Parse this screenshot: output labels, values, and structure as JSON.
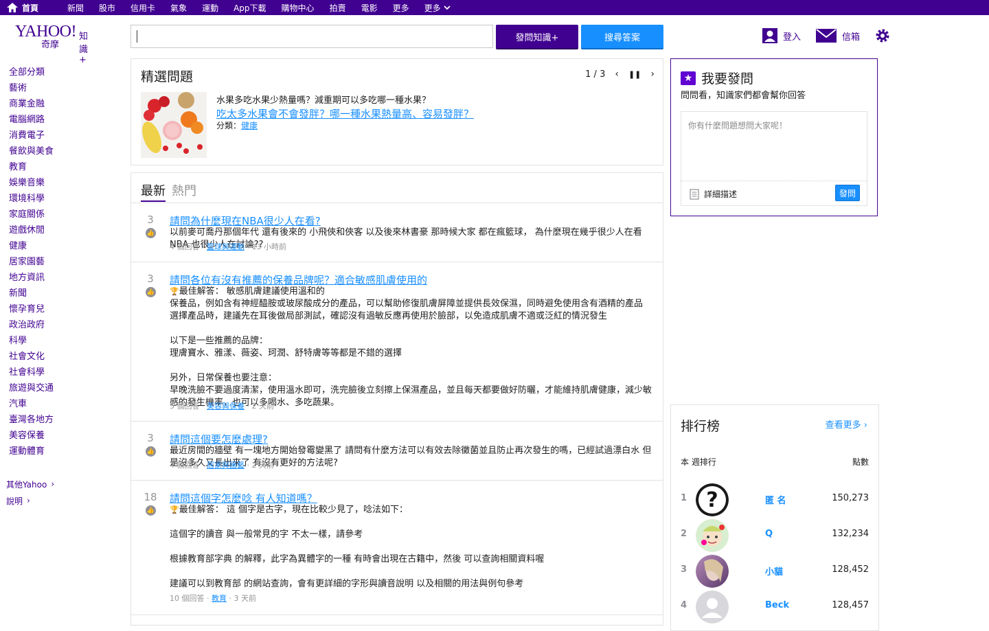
{
  "topnav": {
    "items": [
      "首頁",
      "新聞",
      "股市",
      "信用卡",
      "氣象",
      "運動",
      "App下載",
      "購物中心",
      "拍賣",
      "電影",
      "更多"
    ]
  },
  "header": {
    "logo_main": "YAHOO!",
    "logo_sub": "奇摩",
    "logo_tag": "知識+",
    "ask_button": "發問知識+",
    "search_button": "搜尋答案",
    "account_label": "登入",
    "mail_label": "信箱"
  },
  "leftnav": {
    "items": [
      "全部分類",
      "藝術",
      "商業金融",
      "電腦網路",
      "消費電子",
      "餐飲與美食",
      "教育",
      "娛樂音樂",
      "環境科學",
      "家庭關係",
      "遊戲休閒",
      "健康",
      "居家園藝",
      "地方資訊",
      "新聞",
      "懷孕育兒",
      "政治政府",
      "科學",
      "社會文化",
      "社會科學",
      "旅遊與交通",
      "汽車",
      "臺灣各地方",
      "美容保養",
      "運動體育"
    ],
    "footer": [
      "其他Yahoo",
      "說明"
    ]
  },
  "featured": {
    "title": "精選問題",
    "pager": "1 / 3",
    "desc": "水果多吃水果少熱量嗎？減重期可以多吃哪一種水果？",
    "question": "吃太多水果會不會發胖？哪一種水果熱量高、容易發胖？",
    "cat_prefix": "分類：",
    "category": "健康"
  },
  "tabs": {
    "active": "最新",
    "inactive": "熱門"
  },
  "questions": [
    {
      "votes": "3",
      "title": "請問為什麼現在NBA很少人在看?",
      "body": "以前麥可喬丹那個年代 還有後來的 小飛俠和俠客 以及後來林書豪 那時候大家 都在瘋籃球， 為什麼現在幾乎很少人在看NBA 也很少人在討論??",
      "answers": "4 個回答",
      "category": "籃球與運動",
      "time": "13 小時前"
    },
    {
      "votes": "3",
      "title": "請問各位有沒有推薦的保養品牌呢？適合敏感肌膚使用的",
      "best": "最佳解答： 敏感肌膚建議使用溫和的",
      "body": "保養品，例如含有神經醯胺或玻尿酸成分的產品，可以幫助修復肌膚屏障並提供長效保濕，同時避免使用含有酒精的產品\n選擇產品時，建議先在耳後做局部測試，確認沒有過敏反應再使用於臉部，以免造成肌膚不適或泛紅的情況發生\n\n以下是一些推薦的品牌：\n理膚寶水、雅漾、薇姿、珂潤、舒特膚等等都是不錯的選擇\n\n另外，日常保養也要注意：\n早晚洗臉不要過度清潔，使用溫水即可，洗完臉後立刻擦上保濕產品，並且每天都要做好防曬，才能維持肌膚健康，減少敏感的發生機率，也可以多喝水、多吃蔬果。",
      "answers": "5 個回答",
      "category": "美容與保養",
      "time": "2 天前"
    },
    {
      "votes": "3",
      "title": "請問這個要怎麼處理?",
      "body": "最近房間的牆壁 有一塊地方開始發霉變黑了 請問有什麼方法可以有效去除黴菌並且防止再次發生的嗎，已經試過漂白水 但是沒多久又長出來了 有沒有更好的方法呢?",
      "answers": "4 個回答",
      "category": "居家與園藝",
      "time": "2 天前"
    },
    {
      "votes": "18",
      "title": "請問這個字怎麼唸 有人知道嗎？",
      "best": "最佳解答： 這 個字是古字，現在比較少見了，唸法如下：",
      "body": "\n這個字的讀音 與一般常見的字 不太一樣，請參考\n\n根據教育部字典 的解釋，此字為異體字的一種 有時會出現在古籍中，然後 可以查詢相關資料喔\n\n建議可以到教育部 的網站查詢，會有更詳細的字形與讀音說明 以及相關的用法與例句參考",
      "answers": "10 個回答",
      "category": "教育",
      "time": "3 天前"
    }
  ],
  "askbox": {
    "title": "我要發問",
    "subtitle": "問問看，知識家們都會幫你回答",
    "placeholder": "你有什麼問題想問大家呢！",
    "draft_label": "詳細描述",
    "submit": "發問"
  },
  "leaderboard": {
    "title": "排行榜",
    "more": "查看更多",
    "col_left": "本 週排行",
    "col_right": "點數",
    "rows": [
      {
        "rank": "1",
        "name": "匿 名",
        "points": "150,273"
      },
      {
        "rank": "2",
        "name": "Q",
        "points": "132,234"
      },
      {
        "rank": "3",
        "name": "小貓",
        "points": "128,452"
      },
      {
        "rank": "4",
        "name": "Beck",
        "points": "128,457"
      }
    ]
  },
  "colors": {
    "purple": "#400090",
    "blue": "#188fff",
    "gray": "#959595"
  }
}
